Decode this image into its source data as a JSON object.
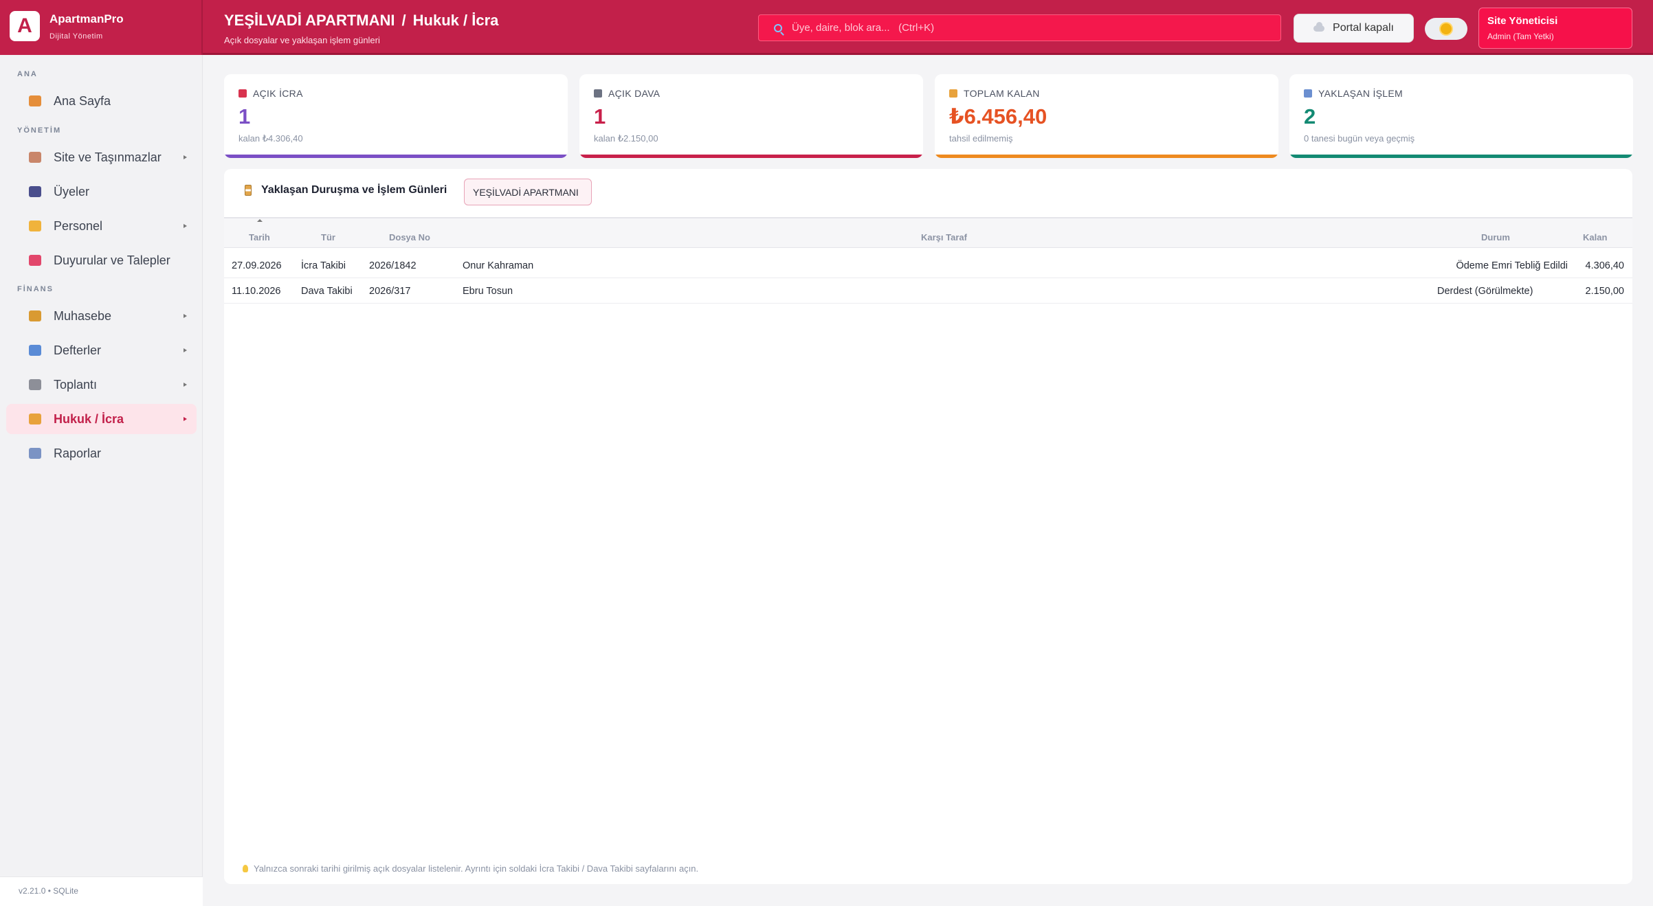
{
  "app": {
    "name": "ApartmanPro",
    "subtitle": "Dijital Yönetim",
    "logo_letter": "A",
    "version": "v2.21.0 • SQLite"
  },
  "header": {
    "site": "YEŞİLVADİ APARTMANI",
    "separator": "/",
    "page": "Hukuk / İcra",
    "subtitle": "Açık dosyalar ve yaklaşan işlem günleri",
    "search_placeholder": "Üye, daire, blok ara...   (Ctrl+K)",
    "portal_label": "Portal kapalı",
    "user_name": "Site Yöneticisi",
    "user_role": "Admin (Tam Yetki)"
  },
  "sidebar": {
    "sections": [
      "ANA",
      "YÖNETİM",
      "FİNANS"
    ],
    "items": [
      {
        "label": "Ana Sayfa",
        "icon": "house-icon",
        "color": "#e58e3a"
      },
      {
        "label": "Site ve Taşınmazlar",
        "icon": "clipboard-icon",
        "color": "#c9866a"
      },
      {
        "label": "Üyeler",
        "icon": "users-icon",
        "color": "#4a4e8c"
      },
      {
        "label": "Personel",
        "icon": "person-icon",
        "color": "#f0b33c"
      },
      {
        "label": "Duyurular ve Talepler",
        "icon": "megaphone-icon",
        "color": "#e2476b"
      },
      {
        "label": "Muhasebe",
        "icon": "money-bag-icon",
        "color": "#d99a32"
      },
      {
        "label": "Defterler",
        "icon": "chart-icon",
        "color": "#5a8bd6"
      },
      {
        "label": "Toplantı",
        "icon": "building-icon",
        "color": "#8d8f98"
      },
      {
        "label": "Hukuk / İcra",
        "icon": "scales-icon",
        "color": "#e8a23c",
        "active": true
      },
      {
        "label": "Raporlar",
        "icon": "trend-icon",
        "color": "#7b93c4"
      }
    ]
  },
  "cards": [
    {
      "title": "AÇIK İCRA",
      "value": "1",
      "sub": "kalan ₺4.306,40",
      "color": "#7b4fc5",
      "icon": "pin-icon"
    },
    {
      "title": "AÇIK DAVA",
      "value": "1",
      "sub": "kalan ₺2.150,00",
      "color": "#c8204a",
      "icon": "courthouse-icon"
    },
    {
      "title": "TOPLAM KALAN",
      "value": "₺6.456,40",
      "sub": "tahsil edilmemiş",
      "color": "#e65223",
      "bar_color": "#ee8a1f",
      "icon": "scales-icon"
    },
    {
      "title": "YAKLAŞAN İŞLEM",
      "value": "2",
      "sub": "0 tanesi bugün veya geçmiş",
      "color": "#138a73",
      "icon": "calendar-icon"
    }
  ],
  "panel": {
    "title": "Yaklaşan Duruşma ve İşlem Günleri",
    "site_filter": "YEŞİLVADİ APARTMANI",
    "columns": [
      "Tarih",
      "Tür",
      "Dosya No",
      "Karşı Taraf",
      "Durum",
      "Kalan"
    ],
    "rows": [
      [
        "27.09.2026",
        "İcra Takibi",
        "2026/1842",
        "Onur Kahraman",
        "Ödeme Emri Tebliğ Edildi",
        "4.306,40"
      ],
      [
        "11.10.2026",
        "Dava Takibi",
        "2026/317",
        "Ebru Tosun",
        "Derdest (Görülmekte)",
        "2.150,00"
      ]
    ],
    "footnote": "Yalnızca sonraki tarihi girilmiş açık dosyalar listelenir. Ayrıntı için soldaki İcra Takibi / Dava Takibi sayfalarını açın."
  }
}
